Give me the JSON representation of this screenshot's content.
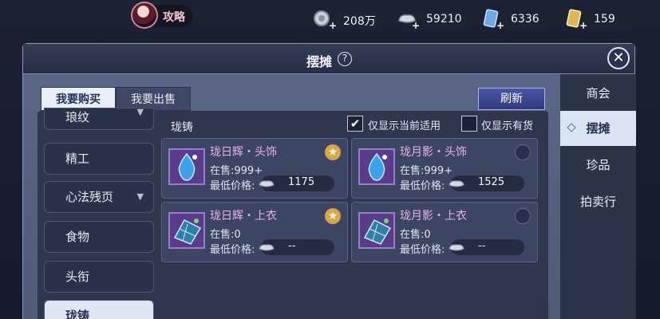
{
  "topbar": {
    "guide_label": "攻略",
    "resources": [
      {
        "icon": "silver-coin-stack-icon",
        "value": "208万"
      },
      {
        "icon": "silver-ingot-icon",
        "value": "59210"
      },
      {
        "icon": "blue-ticket-icon",
        "value": "6336"
      },
      {
        "icon": "gold-ticket-icon",
        "value": "159"
      }
    ]
  },
  "window": {
    "title": "摆摊",
    "help": "?",
    "close": "✕"
  },
  "tabs": {
    "buy": "我要购买",
    "sell": "我要出售"
  },
  "refresh_label": "刷新",
  "categories": [
    {
      "label": "琅纹",
      "has_arrow": true
    },
    {
      "label": "精工",
      "has_arrow": false
    },
    {
      "label": "心法残页",
      "has_arrow": true
    },
    {
      "label": "食物",
      "has_arrow": false
    },
    {
      "label": "头衔",
      "has_arrow": false
    },
    {
      "label": "珑铸",
      "has_arrow": false,
      "selected": true
    }
  ],
  "section_title": "珑铸",
  "filters": {
    "current_only": {
      "label": "仅显示当前适用",
      "checked": true
    },
    "in_stock_only": {
      "label": "仅显示有货",
      "checked": false
    }
  },
  "items": [
    {
      "name": "珑日辉・头饰",
      "stock": "在售:999+",
      "min_label": "最低价格:",
      "price": "1175",
      "favorite": true,
      "icon": "blue-gem-icon"
    },
    {
      "name": "珑月影・头饰",
      "stock": "在售:999+",
      "min_label": "最低价格:",
      "price": "1525",
      "favorite": false,
      "icon": "blue-gem-icon"
    },
    {
      "name": "珑日辉・上衣",
      "stock": "在售:0",
      "min_label": "最低价格:",
      "price": "--",
      "favorite": true,
      "icon": "solar-panel-icon"
    },
    {
      "name": "珑月影・上衣",
      "stock": "在售:0",
      "min_label": "最低价格:",
      "price": "--",
      "favorite": false,
      "icon": "solar-panel-icon"
    }
  ],
  "sidenav": [
    {
      "label": "商会"
    },
    {
      "label": "摆摊",
      "selected": true
    },
    {
      "label": "珍品"
    },
    {
      "label": "拍卖行"
    }
  ],
  "colors": {
    "accent_purple": "#e8b3f0",
    "selected_bg": "#dfe7f5",
    "refresh_blue": "#3d479a",
    "favorite_gold": "#d7a74a"
  }
}
